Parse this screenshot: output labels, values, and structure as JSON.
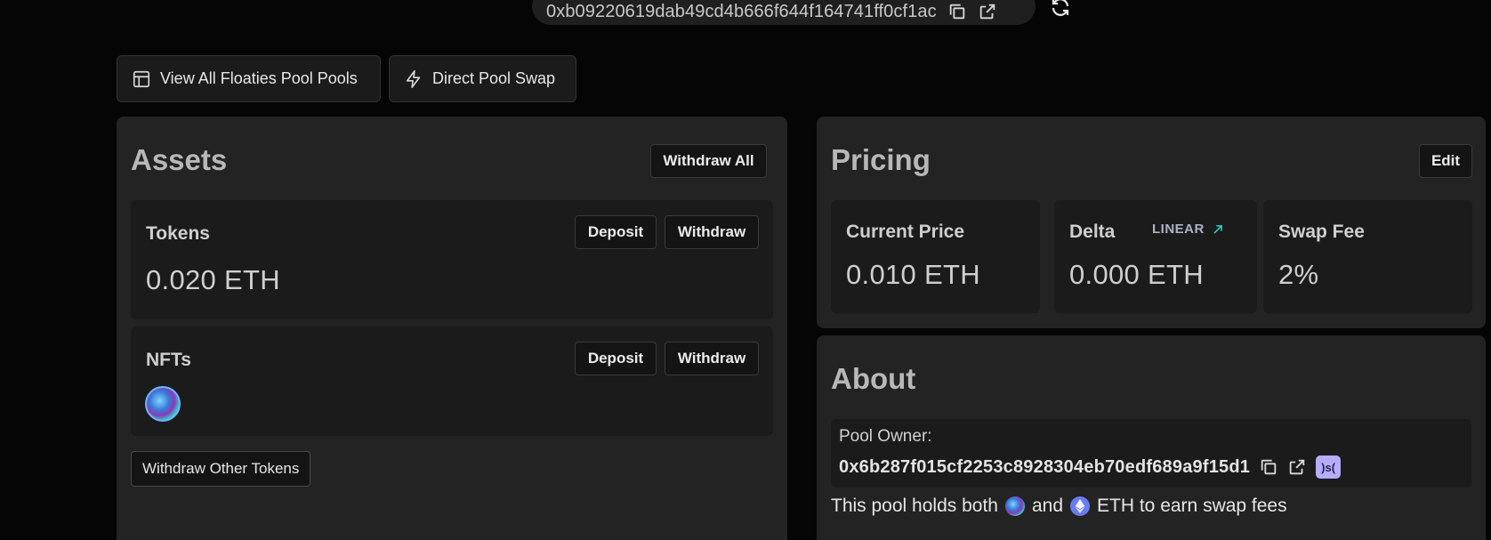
{
  "header": {
    "pool_address": "0xb09220619dab49cd4b666f644f164741ff0cf1ac"
  },
  "toolbar": {
    "view_all_label": "View All Floaties Pool Pools",
    "direct_swap_label": "Direct Pool Swap"
  },
  "assets": {
    "title": "Assets",
    "withdraw_all_label": "Withdraw All",
    "tokens": {
      "label": "Tokens",
      "value": "0.020 ETH",
      "deposit_label": "Deposit",
      "withdraw_label": "Withdraw"
    },
    "nfts": {
      "label": "NFTs",
      "deposit_label": "Deposit",
      "withdraw_label": "Withdraw"
    },
    "withdraw_other_label": "Withdraw Other Tokens"
  },
  "pricing": {
    "title": "Pricing",
    "edit_label": "Edit",
    "current_price": {
      "label": "Current Price",
      "value": "0.010 ETH"
    },
    "delta": {
      "label": "Delta",
      "curve": "LINEAR",
      "value": "0.000 ETH"
    },
    "swap_fee": {
      "label": "Swap Fee",
      "value": "2%"
    }
  },
  "about": {
    "title": "About",
    "owner_label": "Pool Owner:",
    "owner_address": "0x6b287f015cf2253c8928304eb70edf689a9f15d1",
    "ens_badge": ")s(",
    "description_prefix": "This pool holds both",
    "description_and": "and",
    "description_suffix": "ETH to earn swap fees"
  },
  "colors": {
    "background": "#050505",
    "panel": "#232323",
    "card": "#1b1b1b",
    "linear_arrow": "#2ad6c7",
    "ens_badge": "#b6adff"
  },
  "icons": {
    "copy": "copy-icon",
    "external": "external-link-icon",
    "refresh": "refresh-icon",
    "table": "table-icon",
    "bolt": "lightning-icon",
    "linear_arrow": "arrow-up-right-icon",
    "eth": "eth-icon"
  }
}
